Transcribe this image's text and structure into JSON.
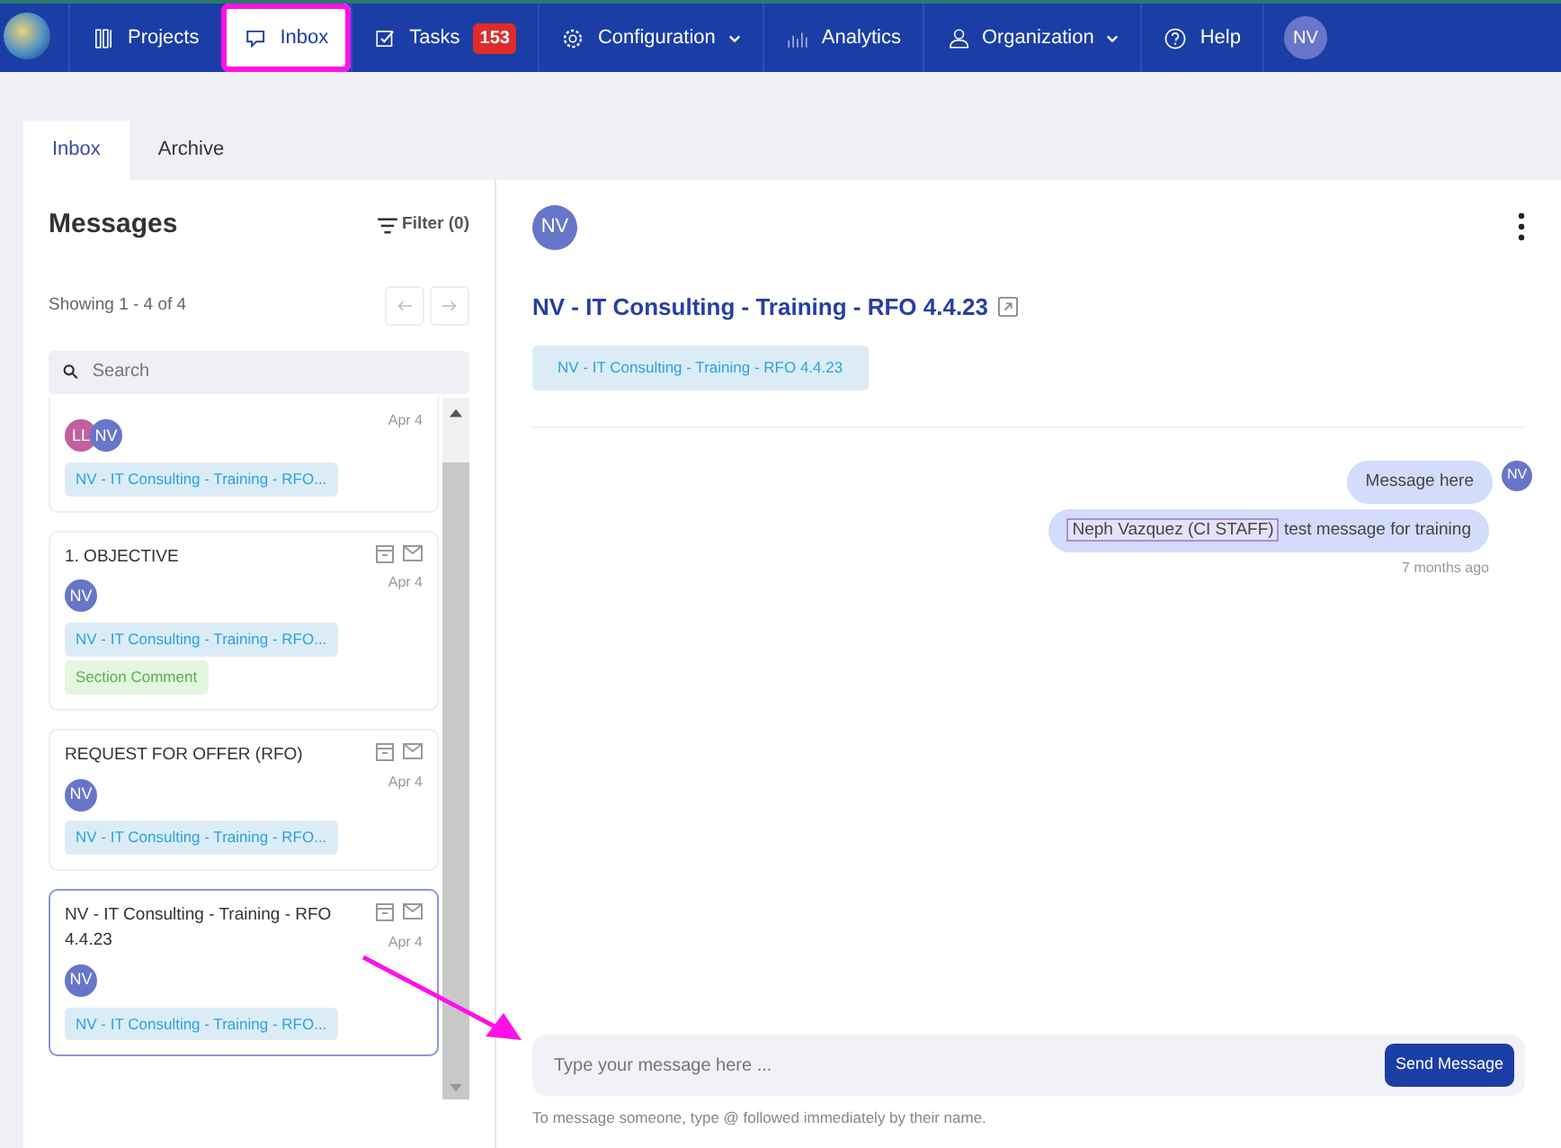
{
  "navbar": {
    "items": [
      {
        "label": "Projects",
        "selected": false,
        "highlighted": false,
        "dropdown": false
      },
      {
        "label": "Inbox",
        "selected": true,
        "highlighted": true,
        "dropdown": false
      },
      {
        "label": "Tasks",
        "selected": false,
        "highlighted": false,
        "dropdown": false,
        "badge": "153"
      },
      {
        "label": "Configuration",
        "selected": false,
        "highlighted": false,
        "dropdown": true
      },
      {
        "label": "Analytics",
        "selected": false,
        "highlighted": false,
        "dropdown": false
      },
      {
        "label": "Organization",
        "selected": false,
        "highlighted": false,
        "dropdown": true
      },
      {
        "label": "Help",
        "selected": false,
        "highlighted": false,
        "dropdown": false
      }
    ],
    "avatar": "NV"
  },
  "tabs": [
    {
      "label": "Inbox",
      "selected": true
    },
    {
      "label": "Archive",
      "selected": false
    }
  ],
  "messages_panel": {
    "title": "Messages",
    "filter": "Filter (0)",
    "showing": "Showing 1 - 4 of 4",
    "search": {
      "placeholder": "Search"
    },
    "items": [
      {
        "avatars": [
          {
            "initials": "LL",
            "color": "#c0609e"
          },
          {
            "initials": "NV",
            "color": "#6776c9"
          }
        ],
        "date": "Apr 4",
        "tags": [
          {
            "label": "NV - IT Consulting - Training - RFO...",
            "kind": "project"
          }
        ],
        "selected": false,
        "actions": false
      },
      {
        "title": "1. OBJECTIVE",
        "avatars": [
          {
            "initials": "NV",
            "color": "#6776c9"
          }
        ],
        "date": "Apr 4",
        "tags": [
          {
            "label": "NV - IT Consulting - Training - RFO...",
            "kind": "project"
          },
          {
            "label": "Section Comment",
            "kind": "comment"
          }
        ],
        "selected": false,
        "actions": true
      },
      {
        "title": "REQUEST FOR OFFER (RFO)",
        "avatars": [
          {
            "initials": "NV",
            "color": "#6776c9"
          }
        ],
        "date": "Apr 4",
        "tags": [
          {
            "label": "NV - IT Consulting - Training - RFO...",
            "kind": "project"
          }
        ],
        "selected": false,
        "actions": true
      },
      {
        "title": "NV - IT Consulting - Training - RFO 4.4.23",
        "avatars": [
          {
            "initials": "NV",
            "color": "#6776c9"
          }
        ],
        "date": "Apr 4",
        "tags": [
          {
            "label": "NV - IT Consulting - Training - RFO...",
            "kind": "project"
          }
        ],
        "selected": true,
        "actions": true
      }
    ]
  },
  "conversation": {
    "avatar": "NV",
    "title": "NV - IT Consulting - Training - RFO 4.4.23",
    "tag": "NV - IT Consulting - Training - RFO 4.4.23",
    "messages": [
      {
        "text": "Message here",
        "avatar": "NV"
      },
      {
        "mention": "Neph Vazquez (CI STAFF)",
        "text": "test message for training"
      }
    ],
    "time": "7 months ago",
    "input": {
      "placeholder": "Type your message here ...",
      "highlighted": true
    },
    "send": "Send Message",
    "hint": "To message someone, type @ followed immediately by their name."
  }
}
